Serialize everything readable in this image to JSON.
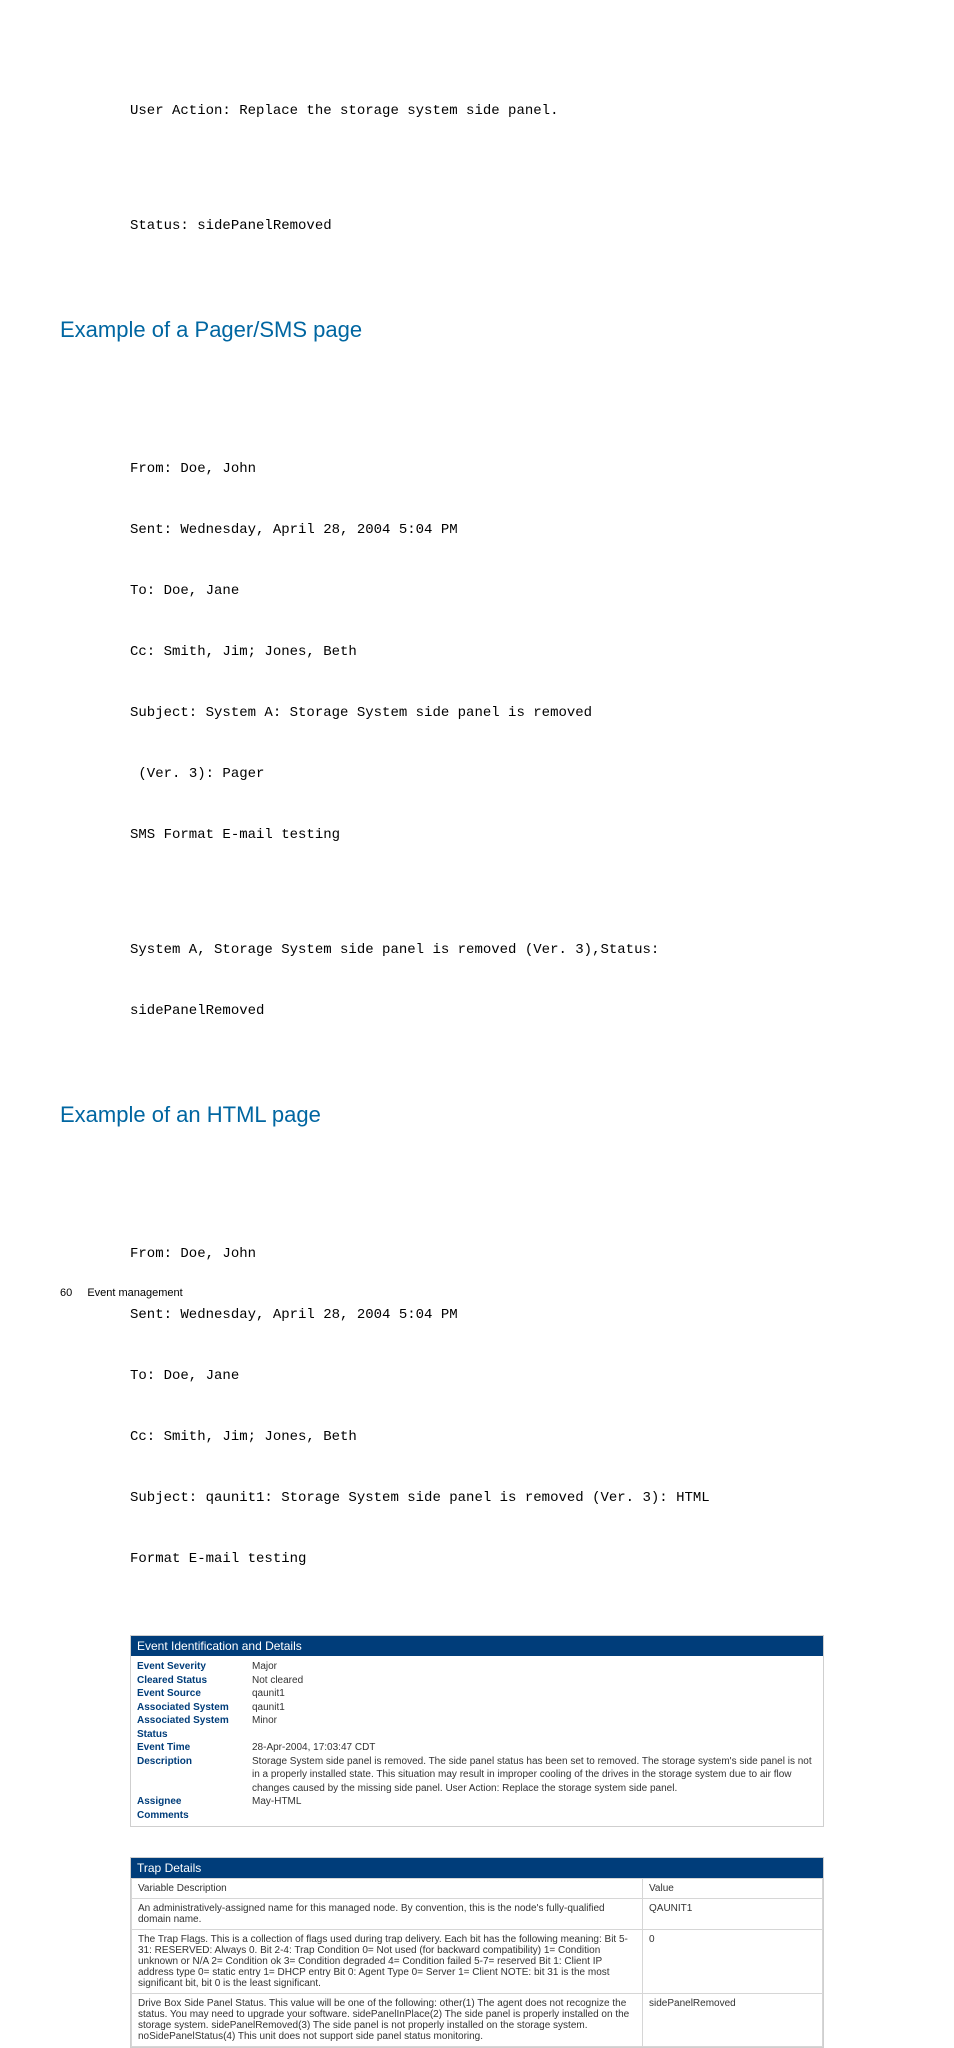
{
  "top_block": {
    "line1": "User Action: Replace the storage system side panel.",
    "line2": "Status: sidePanelRemoved"
  },
  "pager_heading": "Example of a Pager/SMS page",
  "pager_block": {
    "l1": "From: Doe, John",
    "l2": "Sent: Wednesday, April 28, 2004 5:04 PM",
    "l3": "To: Doe, Jane",
    "l4": "Cc: Smith, Jim; Jones, Beth",
    "l5": "Subject: System A: Storage System side panel is removed",
    "l6": " (Ver. 3): Pager",
    "l7": "SMS Format E-mail testing",
    "l8": "System A, Storage System side panel is removed (Ver. 3),Status:",
    "l9": "sidePanelRemoved"
  },
  "html_heading": "Example of an HTML page",
  "html_block": {
    "l1": "From: Doe, John",
    "l2": "Sent: Wednesday, April 28, 2004 5:04 PM",
    "l3": "To: Doe, Jane",
    "l4": "Cc: Smith, Jim; Jones, Beth",
    "l5": "Subject: qaunit1: Storage System side panel is removed (Ver. 3): HTML",
    "l6": "Format E-mail testing"
  },
  "event_table": {
    "title": "Event Identification and Details",
    "rows": [
      {
        "label": "Event Severity",
        "value": "Major"
      },
      {
        "label": "Cleared Status",
        "value": "Not cleared"
      },
      {
        "label": "Event Source",
        "value": "qaunit1"
      },
      {
        "label": "Associated System",
        "value": "qaunit1"
      },
      {
        "label": "Associated System Status",
        "value": "Minor"
      },
      {
        "label": "Event Time",
        "value": "28-Apr-2004, 17:03:47 CDT"
      },
      {
        "label": "Description",
        "value": "Storage System side panel is removed. The side panel status has been set to removed. The storage system's side panel is not in a properly installed state. This situation may result in improper cooling of the drives in the storage system due to air flow changes caused by the missing side panel. User Action: Replace the storage system side panel."
      },
      {
        "label": "Assignee",
        "value": "May-HTML"
      },
      {
        "label": "Comments",
        "value": ""
      }
    ]
  },
  "trap_table": {
    "title": "Trap Details",
    "head_desc": "Variable Description",
    "head_val": "Value",
    "rows": [
      {
        "desc": "An administratively-assigned name for this managed node. By convention, this is the node's fully-qualified domain name.",
        "value": "QAUNIT1"
      },
      {
        "desc": "The Trap Flags. This is a collection of flags used during trap delivery. Each bit has the following meaning: Bit 5-31: RESERVED: Always 0. Bit 2-4: Trap Condition 0= Not used (for backward compatibility) 1= Condition unknown or N/A 2= Condition ok 3= Condition degraded 4= Condition failed 5-7= reserved Bit 1: Client IP address type 0= static entry 1= DHCP entry Bit 0: Agent Type 0= Server 1= Client NOTE: bit 31 is the most significant bit, bit 0 is the least significant.",
        "value": "0"
      },
      {
        "desc": "Drive Box Side Panel Status. This value will be one of the following: other(1) The agent does not recognize the status. You may need to upgrade your software. sidePanelInPlace(2) The side panel is properly installed on the storage system. sidePanelRemoved(3) The side panel is not properly installed on the storage system. noSidePanelStatus(4) This unit does not support side panel status monitoring.",
        "value": "sidePanelRemoved"
      }
    ]
  },
  "footer": {
    "page_num": "60",
    "section": "Event management"
  }
}
